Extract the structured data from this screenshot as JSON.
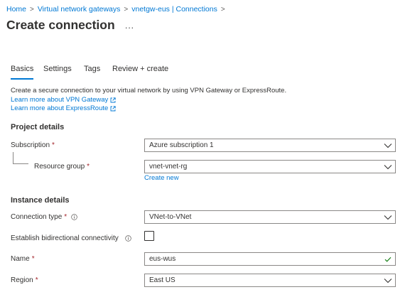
{
  "breadcrumb": {
    "items": [
      "Home",
      "Virtual network gateways",
      "vnetgw-eus | Connections"
    ],
    "separator": ">"
  },
  "page": {
    "title": "Create connection",
    "more": "..."
  },
  "tabs": [
    "Basics",
    "Settings",
    "Tags",
    "Review + create"
  ],
  "active_tab": "Basics",
  "intro": {
    "text": "Create a secure connection to your virtual network by using VPN Gateway or ExpressRoute.",
    "links": [
      "Learn more about VPN Gateway",
      "Learn more about ExpressRoute"
    ]
  },
  "project_details": {
    "heading": "Project details",
    "subscription": {
      "label": "Subscription",
      "value": "Azure subscription 1"
    },
    "resource_group": {
      "label": "Resource group",
      "value": "vnet-vnet-rg",
      "create_new": "Create new"
    }
  },
  "instance_details": {
    "heading": "Instance details",
    "connection_type": {
      "label": "Connection type",
      "value": "VNet-to-VNet"
    },
    "bidirectional": {
      "label": "Establish bidirectional connectivity",
      "checked": false
    },
    "name": {
      "label": "Name",
      "value": "eus-wus"
    },
    "region": {
      "label": "Region",
      "value": "East US"
    }
  },
  "required_marker": "*",
  "colors": {
    "link": "#0078d4",
    "required": "#a4262c",
    "valid": "#107c10",
    "border": "#8a8886"
  }
}
